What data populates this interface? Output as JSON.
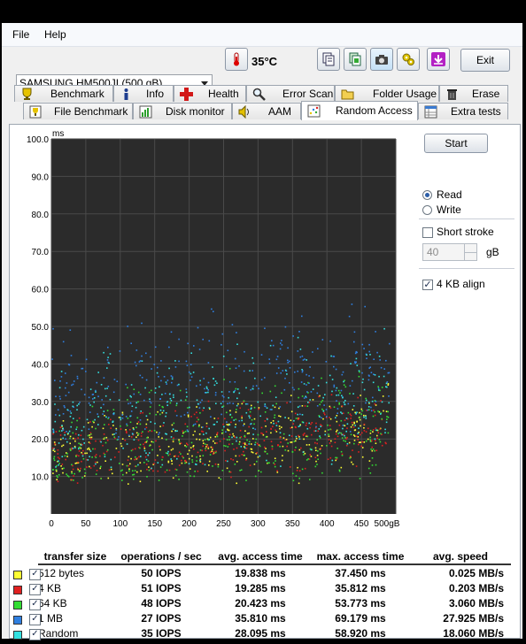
{
  "menu": {
    "file": "File",
    "help": "Help"
  },
  "toolbar": {
    "drive": "SAMSUNG HM500JI (500 gB)",
    "temperature": "35°C",
    "exit_label": "Exit",
    "icons": [
      "copy-text-icon",
      "copy-text-all-icon",
      "screenshot-camera-icon",
      "options-icon",
      "save-down-icon"
    ]
  },
  "tabs": {
    "row1": [
      "Benchmark",
      "Info",
      "Health",
      "Error Scan",
      "Folder Usage",
      "Erase"
    ],
    "row2": [
      "File Benchmark",
      "Disk monitor",
      "AAM",
      "Random Access",
      "Extra tests"
    ],
    "active": "Random Access"
  },
  "controls": {
    "start_label": "Start",
    "read_label": "Read",
    "write_label": "Write",
    "selected_mode": "Read",
    "short_stroke_label": "Short stroke",
    "short_stroke_checked": false,
    "short_stroke_value": "40",
    "short_stroke_unit": "gB",
    "align_label": "4 KB align",
    "align_checked": true
  },
  "chart_data": {
    "type": "scatter",
    "ylabel": "ms",
    "xlabel": "gB",
    "xlim": [
      0,
      500
    ],
    "ylim": [
      0,
      100
    ],
    "x_ticks": [
      "0",
      "50",
      "100",
      "150",
      "200",
      "250",
      "300",
      "350",
      "400",
      "450",
      "500gB"
    ],
    "y_ticks": [
      "10.0",
      "20.0",
      "30.0",
      "40.0",
      "50.0",
      "60.0",
      "70.0",
      "80.0",
      "90.0",
      "100.0"
    ],
    "grid": true,
    "background": "#2b2b2b",
    "series": [
      {
        "name": "512 bytes",
        "color": "#ffff33",
        "avg_ms": 19.838,
        "min_ms": 8,
        "max_ms": 37.45
      },
      {
        "name": "4 KB",
        "color": "#e02020",
        "avg_ms": 19.285,
        "min_ms": 8,
        "max_ms": 35.812
      },
      {
        "name": "64 KB",
        "color": "#33dd33",
        "avg_ms": 20.423,
        "min_ms": 9,
        "max_ms": 53.773
      },
      {
        "name": "1 MB",
        "color": "#2f7fe0",
        "avg_ms": 35.81,
        "min_ms": 20,
        "max_ms": 69.179
      },
      {
        "name": "Random",
        "color": "#33e0e0",
        "avg_ms": 28.095,
        "min_ms": 12,
        "max_ms": 58.92
      }
    ]
  },
  "results": {
    "headers": [
      "transfer size",
      "operations / sec",
      "avg. access time",
      "max. access time",
      "avg. speed"
    ],
    "rows": [
      {
        "name": "512 bytes",
        "color": "#ffff33",
        "ops": "50 IOPS",
        "avg": "19.838 ms",
        "max": "37.450 ms",
        "speed": "0.025 MB/s"
      },
      {
        "name": "4 KB",
        "color": "#e02020",
        "ops": "51 IOPS",
        "avg": "19.285 ms",
        "max": "35.812 ms",
        "speed": "0.203 MB/s"
      },
      {
        "name": "64 KB",
        "color": "#33dd33",
        "ops": "48 IOPS",
        "avg": "20.423 ms",
        "max": "53.773 ms",
        "speed": "3.060 MB/s"
      },
      {
        "name": "1 MB",
        "color": "#2f7fe0",
        "ops": "27 IOPS",
        "avg": "35.810 ms",
        "max": "69.179 ms",
        "speed": "27.925 MB/s"
      },
      {
        "name": "Random",
        "color": "#33e0e0",
        "ops": "35 IOPS",
        "avg": "28.095 ms",
        "max": "58.920 ms",
        "speed": "18.060 MB/s"
      }
    ]
  }
}
